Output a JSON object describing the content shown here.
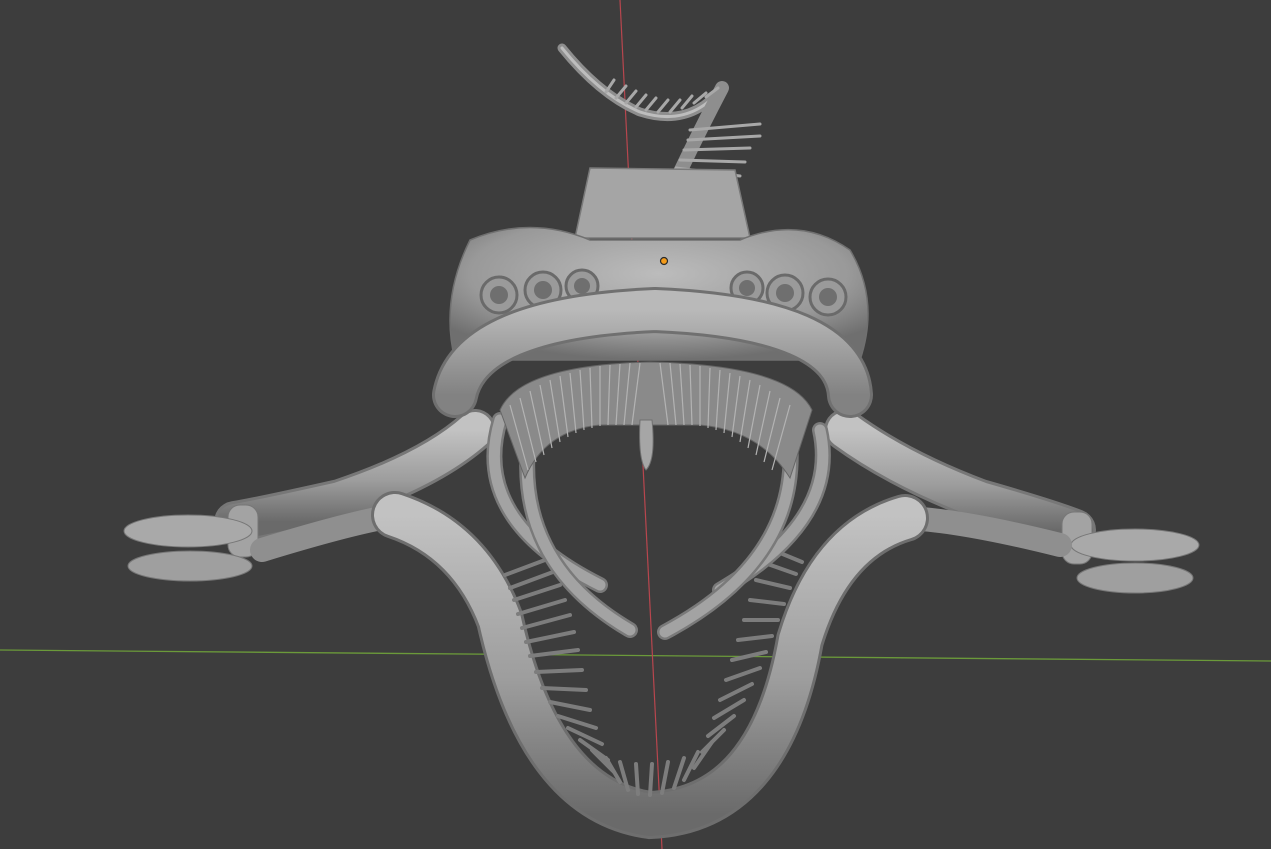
{
  "app": {
    "view": "3d-viewport",
    "shading": "solid"
  },
  "colors": {
    "background": "#3d3d3d",
    "mesh": "#9d9d9d",
    "mesh_highlight": "#c4c4c4",
    "mesh_shadow": "#5c5c5c",
    "x_axis": "#b8464e",
    "y_axis": "#6b9a3a",
    "origin": "#f39b1a"
  },
  "scene": {
    "axes": [
      "x-axis",
      "y-axis"
    ],
    "selected_object_origin_visible": true
  }
}
